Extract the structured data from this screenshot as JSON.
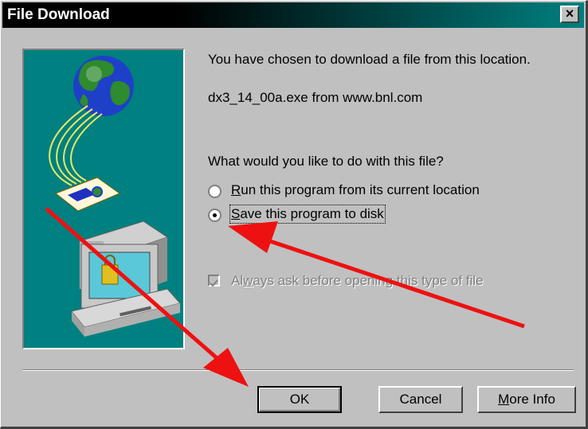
{
  "window": {
    "title": "File Download",
    "close_glyph": "×"
  },
  "content": {
    "intro": "You have chosen to download a file from this location.",
    "source": "dx3_14_00a.exe from www.bnl.com",
    "question": "What would you like to do with this file?"
  },
  "options": {
    "run": {
      "label_first": "R",
      "label_rest": "un this program from its current location",
      "selected": false
    },
    "save": {
      "label_first": "S",
      "label_rest": "ave this program to disk",
      "selected": true
    }
  },
  "always_ask": {
    "before": "Al",
    "accel": "w",
    "after": "ays ask before opening this type of file",
    "checked": true,
    "enabled": false
  },
  "buttons": {
    "ok": "OK",
    "cancel": "Cancel",
    "more_info_first": "M",
    "more_info_rest": "ore Info"
  },
  "colors": {
    "annotation_arrow": "#ee1111",
    "illustration_bg": "#008080"
  },
  "icons": [
    "globe-icon",
    "document-icon",
    "computer-icon",
    "close-icon"
  ]
}
